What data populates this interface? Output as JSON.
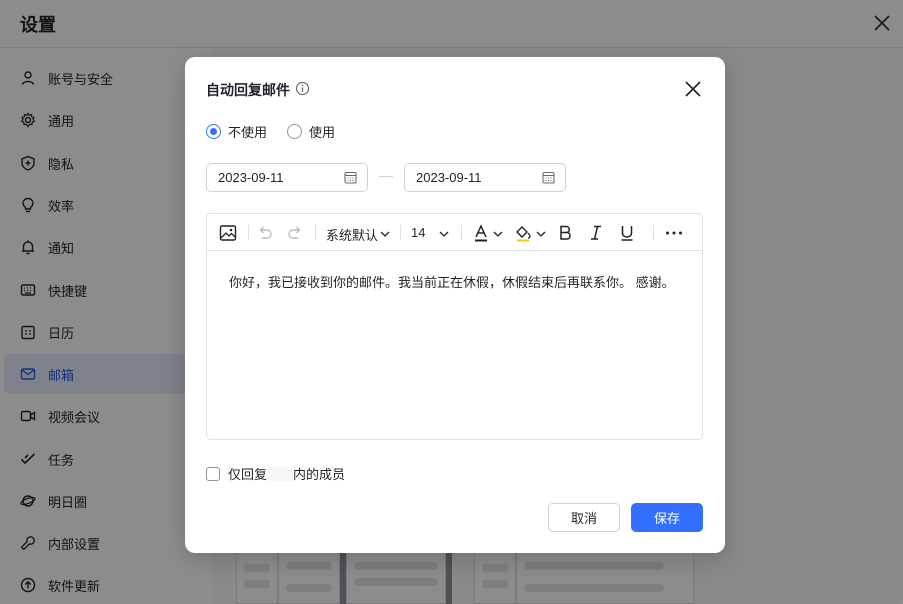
{
  "window": {
    "title": "设置"
  },
  "sidebar": {
    "items": [
      {
        "label": "账号与安全",
        "icon": "user-icon"
      },
      {
        "label": "通用",
        "icon": "gear-icon"
      },
      {
        "label": "隐私",
        "icon": "shield-icon"
      },
      {
        "label": "效率",
        "icon": "bulb-icon"
      },
      {
        "label": "通知",
        "icon": "bell-icon"
      },
      {
        "label": "快捷键",
        "icon": "keyboard-icon"
      },
      {
        "label": "日历",
        "icon": "calendar-icon"
      },
      {
        "label": "邮箱",
        "icon": "mail-icon",
        "active": true
      },
      {
        "label": "视频会议",
        "icon": "video-icon"
      },
      {
        "label": "任务",
        "icon": "task-icon"
      },
      {
        "label": "明日圈",
        "icon": "planet-icon"
      },
      {
        "label": "内部设置",
        "icon": "wrench-icon"
      },
      {
        "label": "软件更新",
        "icon": "update-icon"
      }
    ]
  },
  "dialog": {
    "title": "自动回复邮件",
    "options": [
      {
        "label": "不使用",
        "selected": true
      },
      {
        "label": "使用",
        "selected": false
      }
    ],
    "start_date": "2023-09-11",
    "end_date": "2023-09-11",
    "toolbar": {
      "font_family": "系统默认",
      "font_size": "14"
    },
    "body_text": "你好，我已接收到你的邮件。我当前正在休假，休假结束后再联系你。 感谢。",
    "reply_only_prefix": "仅回复",
    "reply_only_suffix": "内的成员",
    "cancel_label": "取消",
    "save_label": "保存"
  },
  "colors": {
    "accent": "#3370ff",
    "active_bg": "#e8edfb",
    "text": "#1f2329",
    "border": "#dee0e3"
  }
}
